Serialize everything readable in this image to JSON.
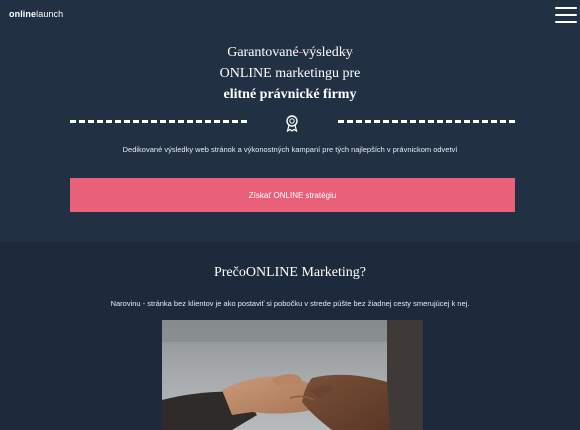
{
  "header": {
    "logo_bold": "online",
    "logo_light": "launch",
    "menu_icon": "hamburger-menu-icon"
  },
  "hero": {
    "title_line1": "Garantované výsledky",
    "title_line2": "ONLINE marketingu pre",
    "title_line3": "elitné právnické firmy",
    "divider_icon": "award-ribbon-icon",
    "subtitle": "Dedikované výsledky web stránok a výkonostných kampaní pre tých najlepších v právnickom odvetví",
    "cta_label": "Získať ONLINE stratégiu",
    "accent_color": "#e8607a"
  },
  "why": {
    "title_prefix": "Prečo",
    "title_main": "ONLINE Marketing",
    "title_suffix": "?",
    "text": "Narovinu - stránka bez klientov je ako postaviť si pobočku v strede púšte bez žiadnej cesty smerujúcej k nej.",
    "image": "handshake-photo"
  },
  "colors": {
    "hero_bg": "#213043",
    "page_bg": "#1d2a3b"
  }
}
